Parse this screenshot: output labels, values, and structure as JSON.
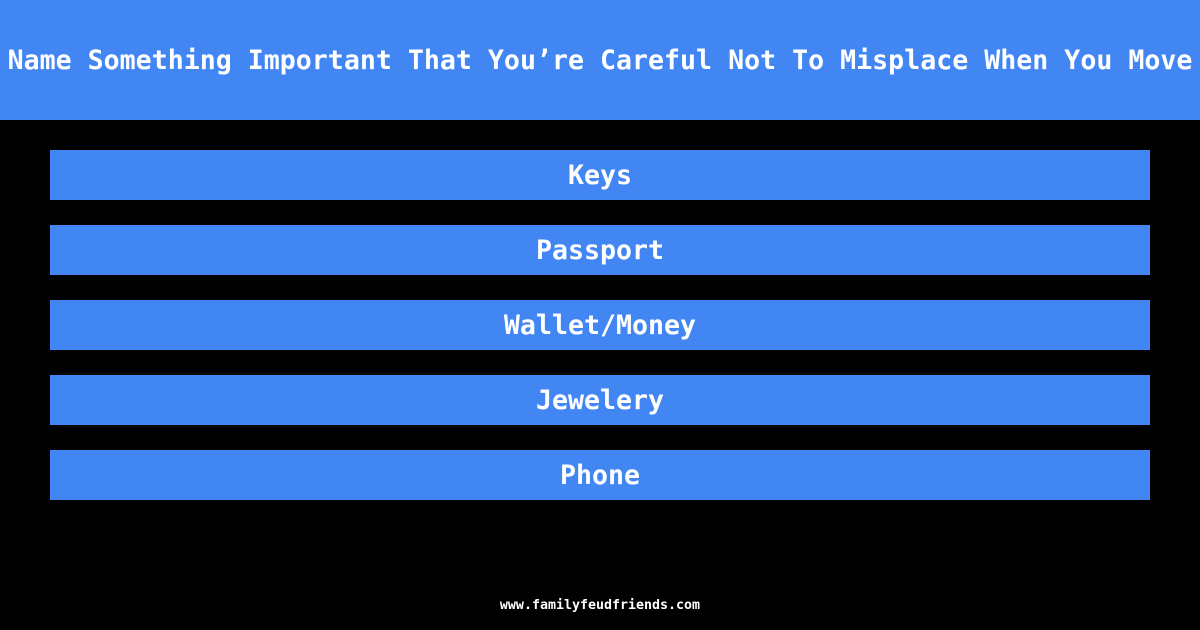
{
  "question": "Name Something Important That You’re Careful Not To Misplace When You Move",
  "answers": [
    "Keys",
    "Passport",
    "Wallet/Money",
    "Jewelery",
    "Phone"
  ],
  "footer": "www.familyfeudfriends.com",
  "colors": {
    "accent": "#4286f4",
    "background": "#000000"
  }
}
